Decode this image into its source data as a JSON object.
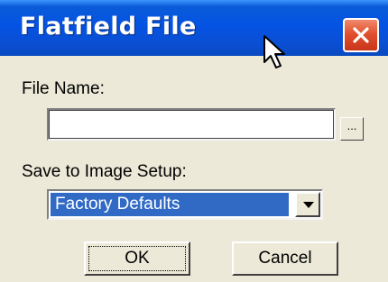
{
  "window": {
    "title": "Flatfield File",
    "close_icon": "close-icon"
  },
  "form": {
    "file_name_label": "File Name:",
    "file_name_value": "",
    "browse_label": "...",
    "setup_label": "Save to Image Setup:",
    "setup_selected": "Factory Defaults"
  },
  "buttons": {
    "ok": "OK",
    "cancel": "Cancel"
  },
  "colors": {
    "titlebar": "#0553e3",
    "dialog_bg": "#ece9d8",
    "selection": "#316ac5",
    "close_button": "#e2512e"
  }
}
